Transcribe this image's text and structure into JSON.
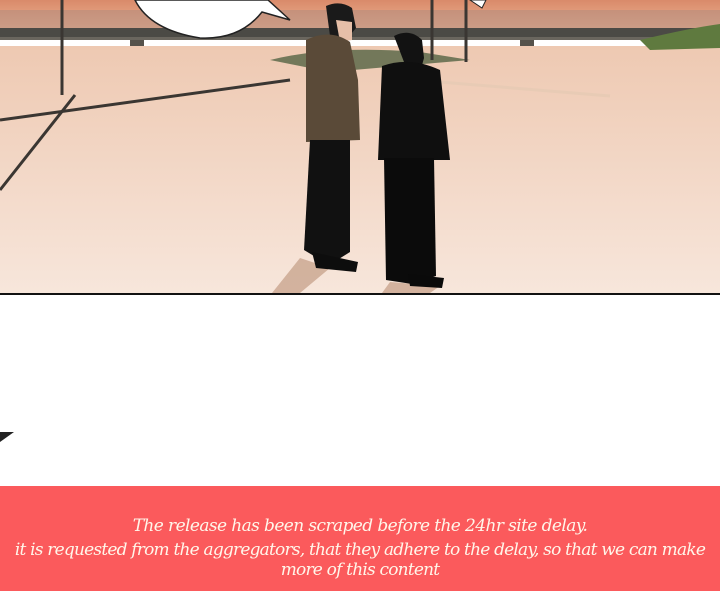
{
  "panel": {
    "scene": "two-figures-riverbank-sunset",
    "colors": {
      "sky": "#f2b98f",
      "ground": "#f3d8c6",
      "bridge": "#4a4a46"
    }
  },
  "notice": {
    "line1": "The release has been scraped before the 24hr site delay.",
    "line2": "it is requested from the aggregators, that they adhere to the delay, so that we can make more of this content",
    "background": "#fb5a5c"
  }
}
